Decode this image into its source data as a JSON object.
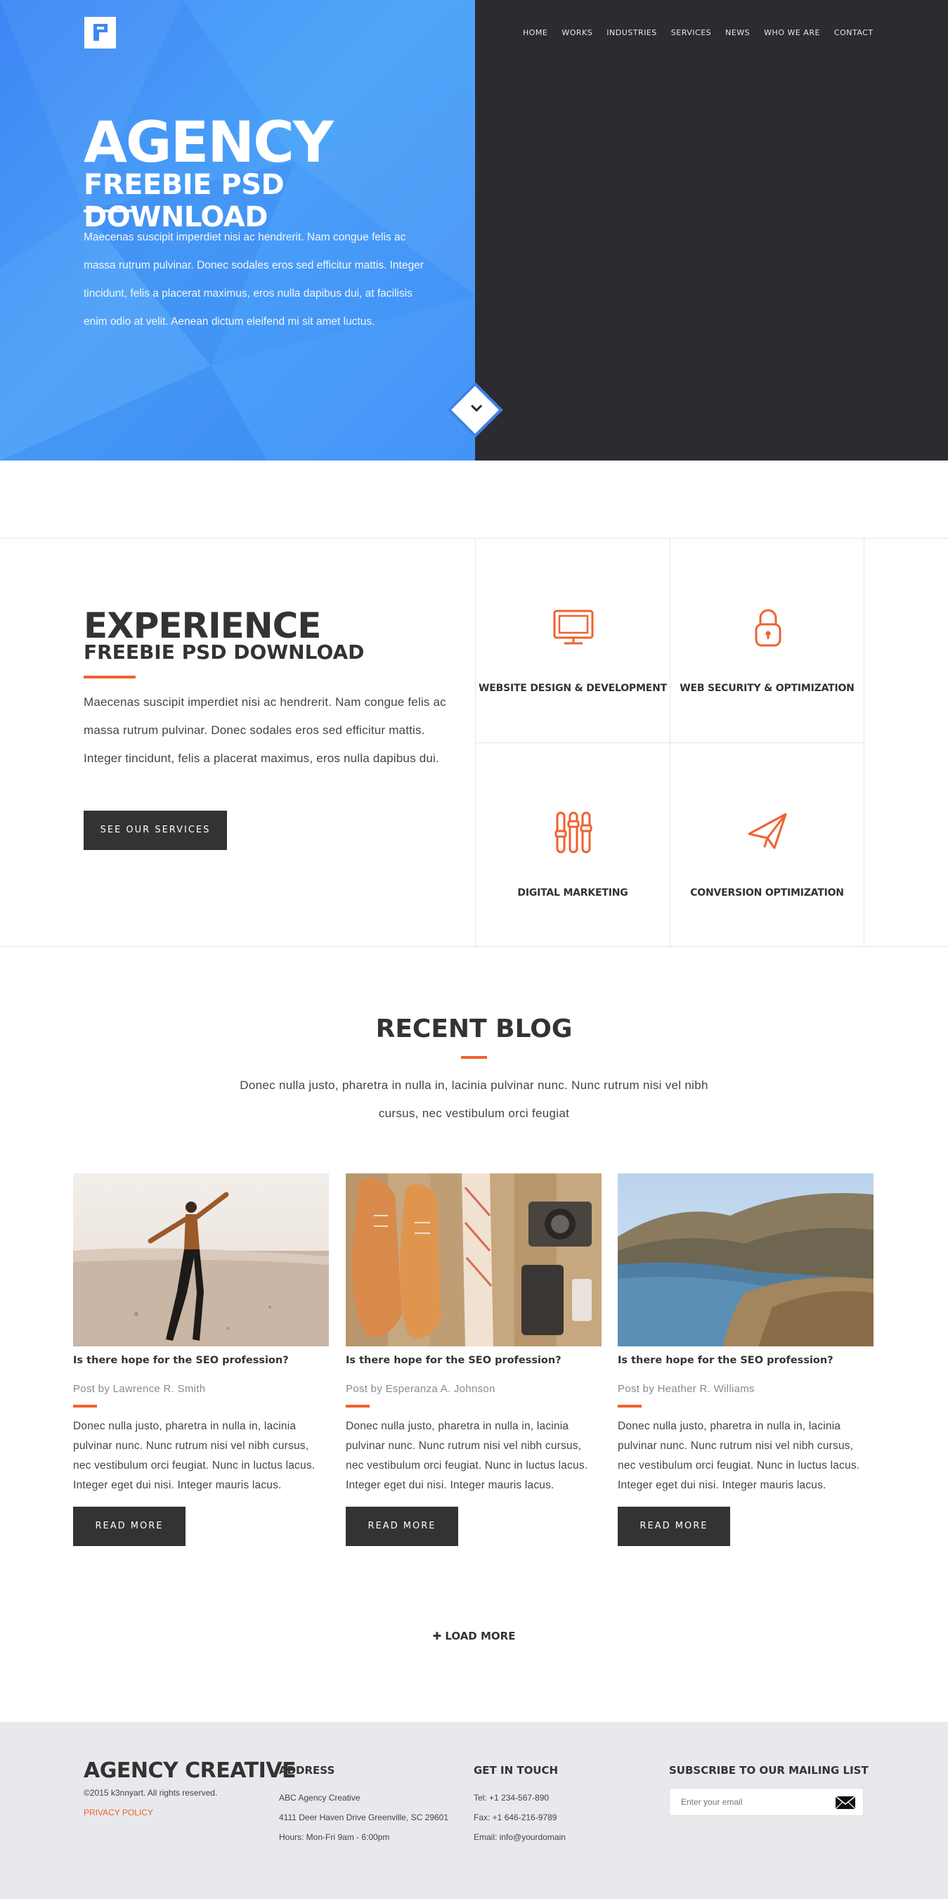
{
  "nav": {
    "items": [
      "HOME",
      "WORKS",
      "INDUSTRIES",
      "SERVICES",
      "NEWS",
      "WHO WE ARE",
      "CONTACT"
    ]
  },
  "hero": {
    "title": "AGENCY",
    "subtitle": "FREEBIE PSD DOWNLOAD",
    "text": "Maecenas suscipit imperdiet nisi ac hendrerit. Nam congue felis ac massa rutrum pulvinar. Donec sodales eros sed efficitur mattis. Integer tincidunt, felis a placerat maximus, eros nulla dapibus dui, at facilisis enim odio at velit. Aenean dictum eleifend mi sit amet luctus.",
    "scroll_icon": "chevron-down-icon"
  },
  "experience": {
    "title": "EXPERIENCE",
    "subtitle": "FREEBIE PSD DOWNLOAD",
    "text": "Maecenas suscipit imperdiet nisi ac hendrerit. Nam congue felis ac massa rutrum pulvinar. Donec sodales eros sed efficitur mattis. Integer tincidunt, felis a placerat maximus, eros nulla dapibus dui.",
    "button": "SEE OUR SERVICES",
    "services": [
      {
        "label": "WEBSITE DESIGN & DEVELOPMENT",
        "icon": "monitor-icon"
      },
      {
        "label": "WEB SECURITY & OPTIMIZATION",
        "icon": "lock-icon"
      },
      {
        "label": "DIGITAL MARKETING",
        "icon": "sliders-icon"
      },
      {
        "label": "CONVERSION OPTIMIZATION",
        "icon": "paper-plane-icon"
      }
    ]
  },
  "blog": {
    "title": "RECENT BLOG",
    "desc": "Donec nulla justo, pharetra in nulla in, lacinia pulvinar nunc. Nunc rutrum nisi vel nibh cursus, nec vestibulum orci feugiat",
    "posts": [
      {
        "title": "Is there hope for the SEO profession?",
        "by": "Post by Lawrence R. Smith",
        "text": "Donec nulla justo, pharetra in nulla in, lacinia pulvinar nunc. Nunc rutrum nisi vel nibh cursus, nec vestibulum orci feugiat. Nunc in luctus lacus. Integer eget dui nisi. Integer mauris lacus.",
        "button": "READ MORE"
      },
      {
        "title": "Is there hope for the SEO profession?",
        "by": "Post by Esperanza A. Johnson",
        "text": "Donec nulla justo, pharetra in nulla in, lacinia pulvinar nunc. Nunc rutrum nisi vel nibh cursus, nec vestibulum orci feugiat. Nunc in luctus lacus. Integer eget dui nisi. Integer mauris lacus.",
        "button": "READ MORE"
      },
      {
        "title": "Is there hope for the SEO profession?",
        "by": "Post by Heather R. Williams",
        "text": "Donec nulla justo, pharetra in nulla in, lacinia pulvinar nunc. Nunc rutrum nisi vel nibh cursus, nec vestibulum orci feugiat. Nunc in luctus lacus. Integer eget dui nisi. Integer mauris lacus.",
        "button": "READ MORE"
      }
    ],
    "load_more": "LOAD MORE"
  },
  "footer": {
    "brand": "AGENCY CREATIVE",
    "copyright": "©2015 k3nnyart. All rights reserved.",
    "privacy": "PRIVACY POLICY",
    "address": {
      "heading": "ADDRESS",
      "line1": "ABC Agency Creative",
      "line2": "4111 Deer Haven Drive Greenville, SC 29601",
      "line3": "Hours: Mon-Fri 9am - 6:00pm"
    },
    "contact": {
      "heading": "GET IN TOUCH",
      "tel": "Tel: +1 234-567-890",
      "fax": "Fax: +1 646-216-9789",
      "email": "Email: info@yourdomain"
    },
    "subscribe": {
      "heading": "SUBSCRIBE TO OUR MAILING LIST",
      "placeholder": "Enter your email"
    }
  },
  "colors": {
    "accent": "#f0612e",
    "hero_blue": "#3d86f5",
    "dark": "#2c2b30",
    "button": "#333333",
    "footer_bg": "#e8e9ed"
  }
}
